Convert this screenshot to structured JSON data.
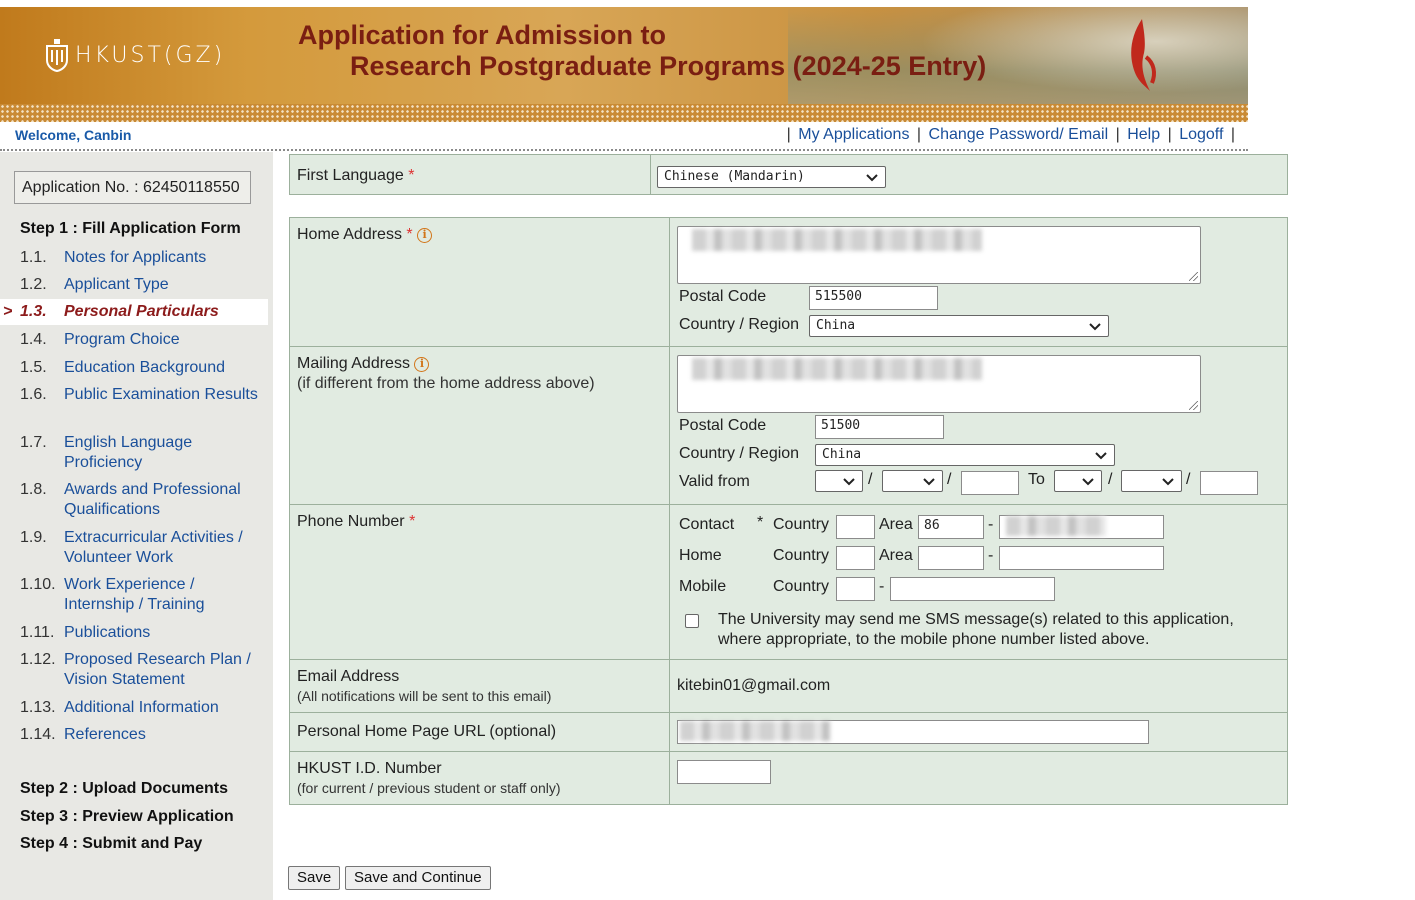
{
  "header": {
    "logo_text": "HKUST(GZ)",
    "title_line1": "Application for Admission to",
    "title_line2": "Research Postgraduate Programs (2024-25 Entry)"
  },
  "topbar": {
    "welcome": "Welcome, Canbin",
    "links": [
      "My Applications",
      "Change Password/ Email",
      "Help",
      "Logoff"
    ],
    "separator": "|"
  },
  "sidebar": {
    "application_no": "Application No. : 62450118550",
    "step1": "Step 1 : Fill Application Form",
    "items": [
      {
        "num": "1.1.",
        "label": "Notes for Applicants"
      },
      {
        "num": "1.2.",
        "label": "Applicant Type"
      },
      {
        "num": "1.3.",
        "label": "Personal Particulars",
        "active": true,
        "marker": ">"
      },
      {
        "num": "1.4.",
        "label": "Program Choice"
      },
      {
        "num": "1.5.",
        "label": "Education Background"
      },
      {
        "num": "1.6.",
        "label": "Public Examination Results"
      },
      {
        "num": "1.7.",
        "label": "English Language Proficiency"
      },
      {
        "num": "1.8.",
        "label": "Awards and Professional Qualifications"
      },
      {
        "num": "1.9.",
        "label": "Extracurricular Activities / Volunteer Work"
      },
      {
        "num": "1.10.",
        "label": "Work Experience / Internship / Training"
      },
      {
        "num": "1.11.",
        "label": "Publications"
      },
      {
        "num": "1.12.",
        "label": "Proposed Research Plan / Vision Statement"
      },
      {
        "num": "1.13.",
        "label": "Additional Information"
      },
      {
        "num": "1.14.",
        "label": "References"
      }
    ],
    "step2": "Step 2 : Upload Documents",
    "step3": "Step 3 : Preview Application",
    "step4": "Step 4 : Submit and Pay"
  },
  "form": {
    "first_language": {
      "label": "First Language",
      "required": "*",
      "value": "Chinese (Mandarin)"
    },
    "home_address": {
      "label": "Home Address",
      "required": "*",
      "postal_code_label": "Postal Code",
      "postal_code": "515500",
      "country_label": "Country / Region",
      "country": "China"
    },
    "mailing_address": {
      "label": "Mailing Address",
      "note": "(if different from the home address above)",
      "postal_code_label": "Postal Code",
      "postal_code": "51500",
      "country_label": "Country / Region",
      "country": "China",
      "valid_from_label": "Valid from",
      "to_label": "To",
      "slash": "/"
    },
    "phone": {
      "label": "Phone Number",
      "required": "*",
      "contact_label": "Contact",
      "home_label": "Home",
      "mobile_label": "Mobile",
      "country_label": "Country",
      "area_label": "Area",
      "dash": "-",
      "contact_area": "86",
      "sms_text": "The University may send me SMS message(s) related to this application, where appropriate, to the mobile phone number listed above."
    },
    "email": {
      "label": "Email Address",
      "note": "(All notifications will be sent to this email)",
      "value": "kitebin01@gmail.com"
    },
    "homepage": {
      "label": "Personal Home Page URL (optional)"
    },
    "hkust_id": {
      "label": "HKUST I.D. Number",
      "note": "(for current / previous student or staff only)"
    }
  },
  "buttons": {
    "save": "Save",
    "save_continue": "Save and Continue"
  }
}
